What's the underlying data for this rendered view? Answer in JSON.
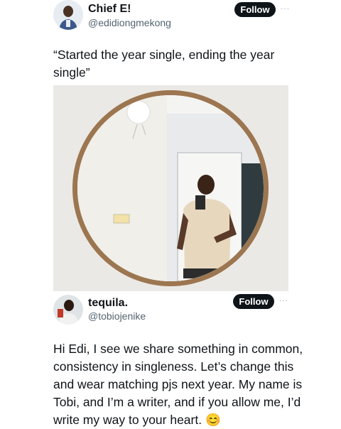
{
  "post1": {
    "author_name": "Chief E!",
    "author_handle": "@edidiongmekong",
    "follow_label": "Follow",
    "more_label": "···",
    "text_line1": "“Started the year single, ending the year",
    "text_line2": "single”",
    "image_alt": "Mirror selfie of a man in a round mirror"
  },
  "post2": {
    "author_name": "tequila.",
    "author_handle": "@tobiojenike",
    "follow_label": "Follow",
    "more_label": "···",
    "text_lines": [
      "Hi Edi, I see we share something in common,",
      "consistency in singleness. Let’s change this",
      "and wear matching pjs next year. My name is",
      "Tobi, and I’m a writer, and if you allow me, I’d",
      "write my way to your heart. 😊"
    ]
  },
  "colors": {
    "text": "#0f1419",
    "secondary": "#536471",
    "button_bg": "#0f1419",
    "button_text": "#ffffff"
  }
}
